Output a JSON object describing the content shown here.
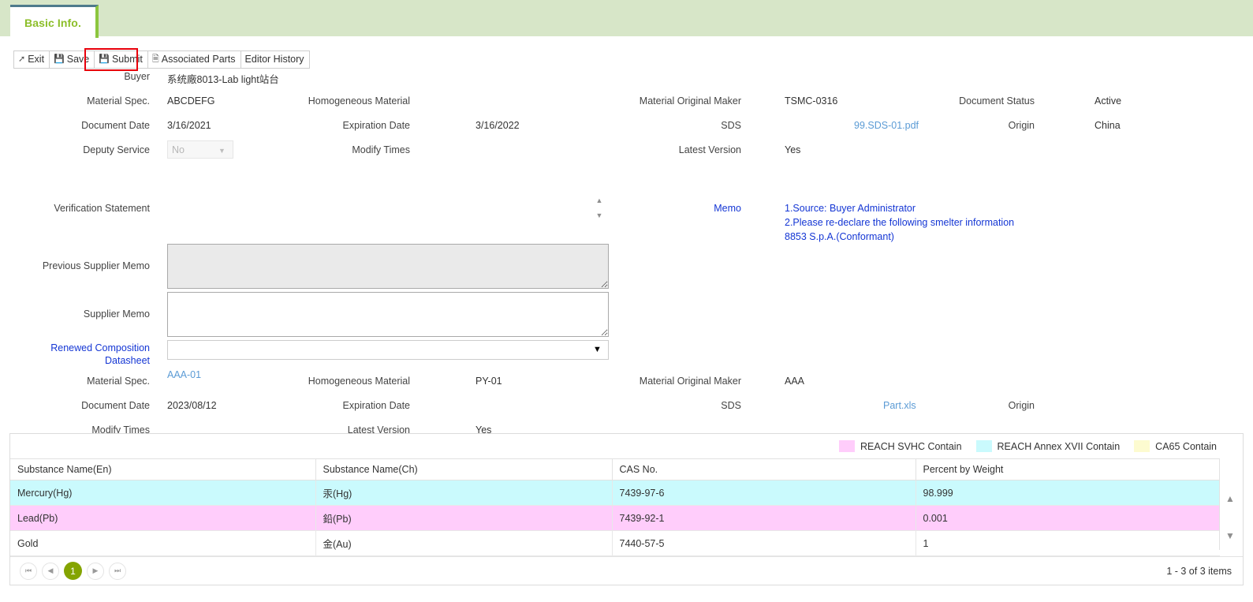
{
  "tab": {
    "label": "Basic Info."
  },
  "toolbar": {
    "exit": "Exit",
    "save": "Save",
    "submit": "Submit",
    "associated_parts": "Associated Parts",
    "editor_history": "Editor History",
    "exit_icon": "exit-arrow-icon",
    "save_icon": "floppy-disk-icon",
    "submit_icon": "floppy-disk-icon",
    "parts_icon": "document-icon"
  },
  "form": {
    "buyer_label": "Buyer",
    "buyer_value": "系统廠8013-Lab light站台",
    "material_spec_label": "Material Spec.",
    "material_spec_value": "ABCDEFG",
    "homogeneous_material_label": "Homogeneous Material",
    "homogeneous_material_value": "",
    "material_original_maker_label": "Material Original Maker",
    "material_original_maker_value": "TSMC-0316",
    "document_status_label": "Document Status",
    "document_status_value": "Active",
    "document_date_label": "Document Date",
    "document_date_value": "3/16/2021",
    "expiration_date_label": "Expiration Date",
    "expiration_date_value": "3/16/2022",
    "sds_label": "SDS",
    "sds_value": "99.SDS-01.pdf",
    "origin_label": "Origin",
    "origin_value": "China",
    "deputy_service_label": "Deputy Service",
    "deputy_service_value": "No",
    "modify_times_label": "Modify Times",
    "modify_times_value": "",
    "latest_version_label": "Latest Version",
    "latest_version_value": "Yes",
    "verification_statement_label": "Verification Statement",
    "verification_statement_value": "",
    "memo_label": "Memo",
    "memo_line1": "1.Source: Buyer Administrator",
    "memo_line2": "2.Please re-declare the following smelter information",
    "memo_line3": "8853 S.p.A.(Conformant)",
    "previous_supplier_memo_label": "Previous Supplier Memo",
    "previous_supplier_memo_value": "",
    "supplier_memo_label": "Supplier Memo",
    "supplier_memo_value": "",
    "renewed_line1": "Renewed Composition",
    "renewed_line2": "Datasheet",
    "renewed_value": ""
  },
  "renewed_section": {
    "material_spec_label": "Material Spec.",
    "material_spec_value": "AAA-01",
    "homogeneous_material_label": "Homogeneous Material",
    "homogeneous_material_value": "PY-01",
    "material_original_maker_label": "Material Original Maker",
    "material_original_maker_value": "AAA",
    "document_date_label": "Document Date",
    "document_date_value": "2023/08/12",
    "expiration_date_label": "Expiration Date",
    "expiration_date_value": "",
    "sds_label": "SDS",
    "sds_value": "Part.xls",
    "origin_label": "Origin",
    "origin_value": "",
    "modify_times_label": "Modify Times",
    "modify_times_value": "",
    "latest_version_label": "Latest Version",
    "latest_version_value": "Yes"
  },
  "legend": [
    {
      "label": "REACH SVHC Contain",
      "color": "#ffcdfb"
    },
    {
      "label": "REACH Annex XVII Contain",
      "color": "#cafafd"
    },
    {
      "label": "CA65 Contain",
      "color": "#fdfbd0"
    }
  ],
  "table": {
    "columns": [
      "Substance Name(En)",
      "Substance Name(Ch)",
      "CAS No.",
      "Percent by Weight"
    ],
    "rows": [
      {
        "name_en": "Mercury(Hg)",
        "name_ch": "汞(Hg)",
        "cas": "7439-97-6",
        "percent": "98.999",
        "highlight": "cyan"
      },
      {
        "name_en": "Lead(Pb)",
        "name_ch": "鉛(Pb)",
        "cas": "7439-92-1",
        "percent": "0.001",
        "highlight": "pink"
      },
      {
        "name_en": "Gold",
        "name_ch": "金(Au)",
        "cas": "7440-57-5",
        "percent": "1",
        "highlight": "none"
      }
    ]
  },
  "pager": {
    "first": "⏮",
    "prev": "◀",
    "page": "1",
    "next": "▶",
    "last": "⏭",
    "info": "1 - 3 of 3 items"
  }
}
